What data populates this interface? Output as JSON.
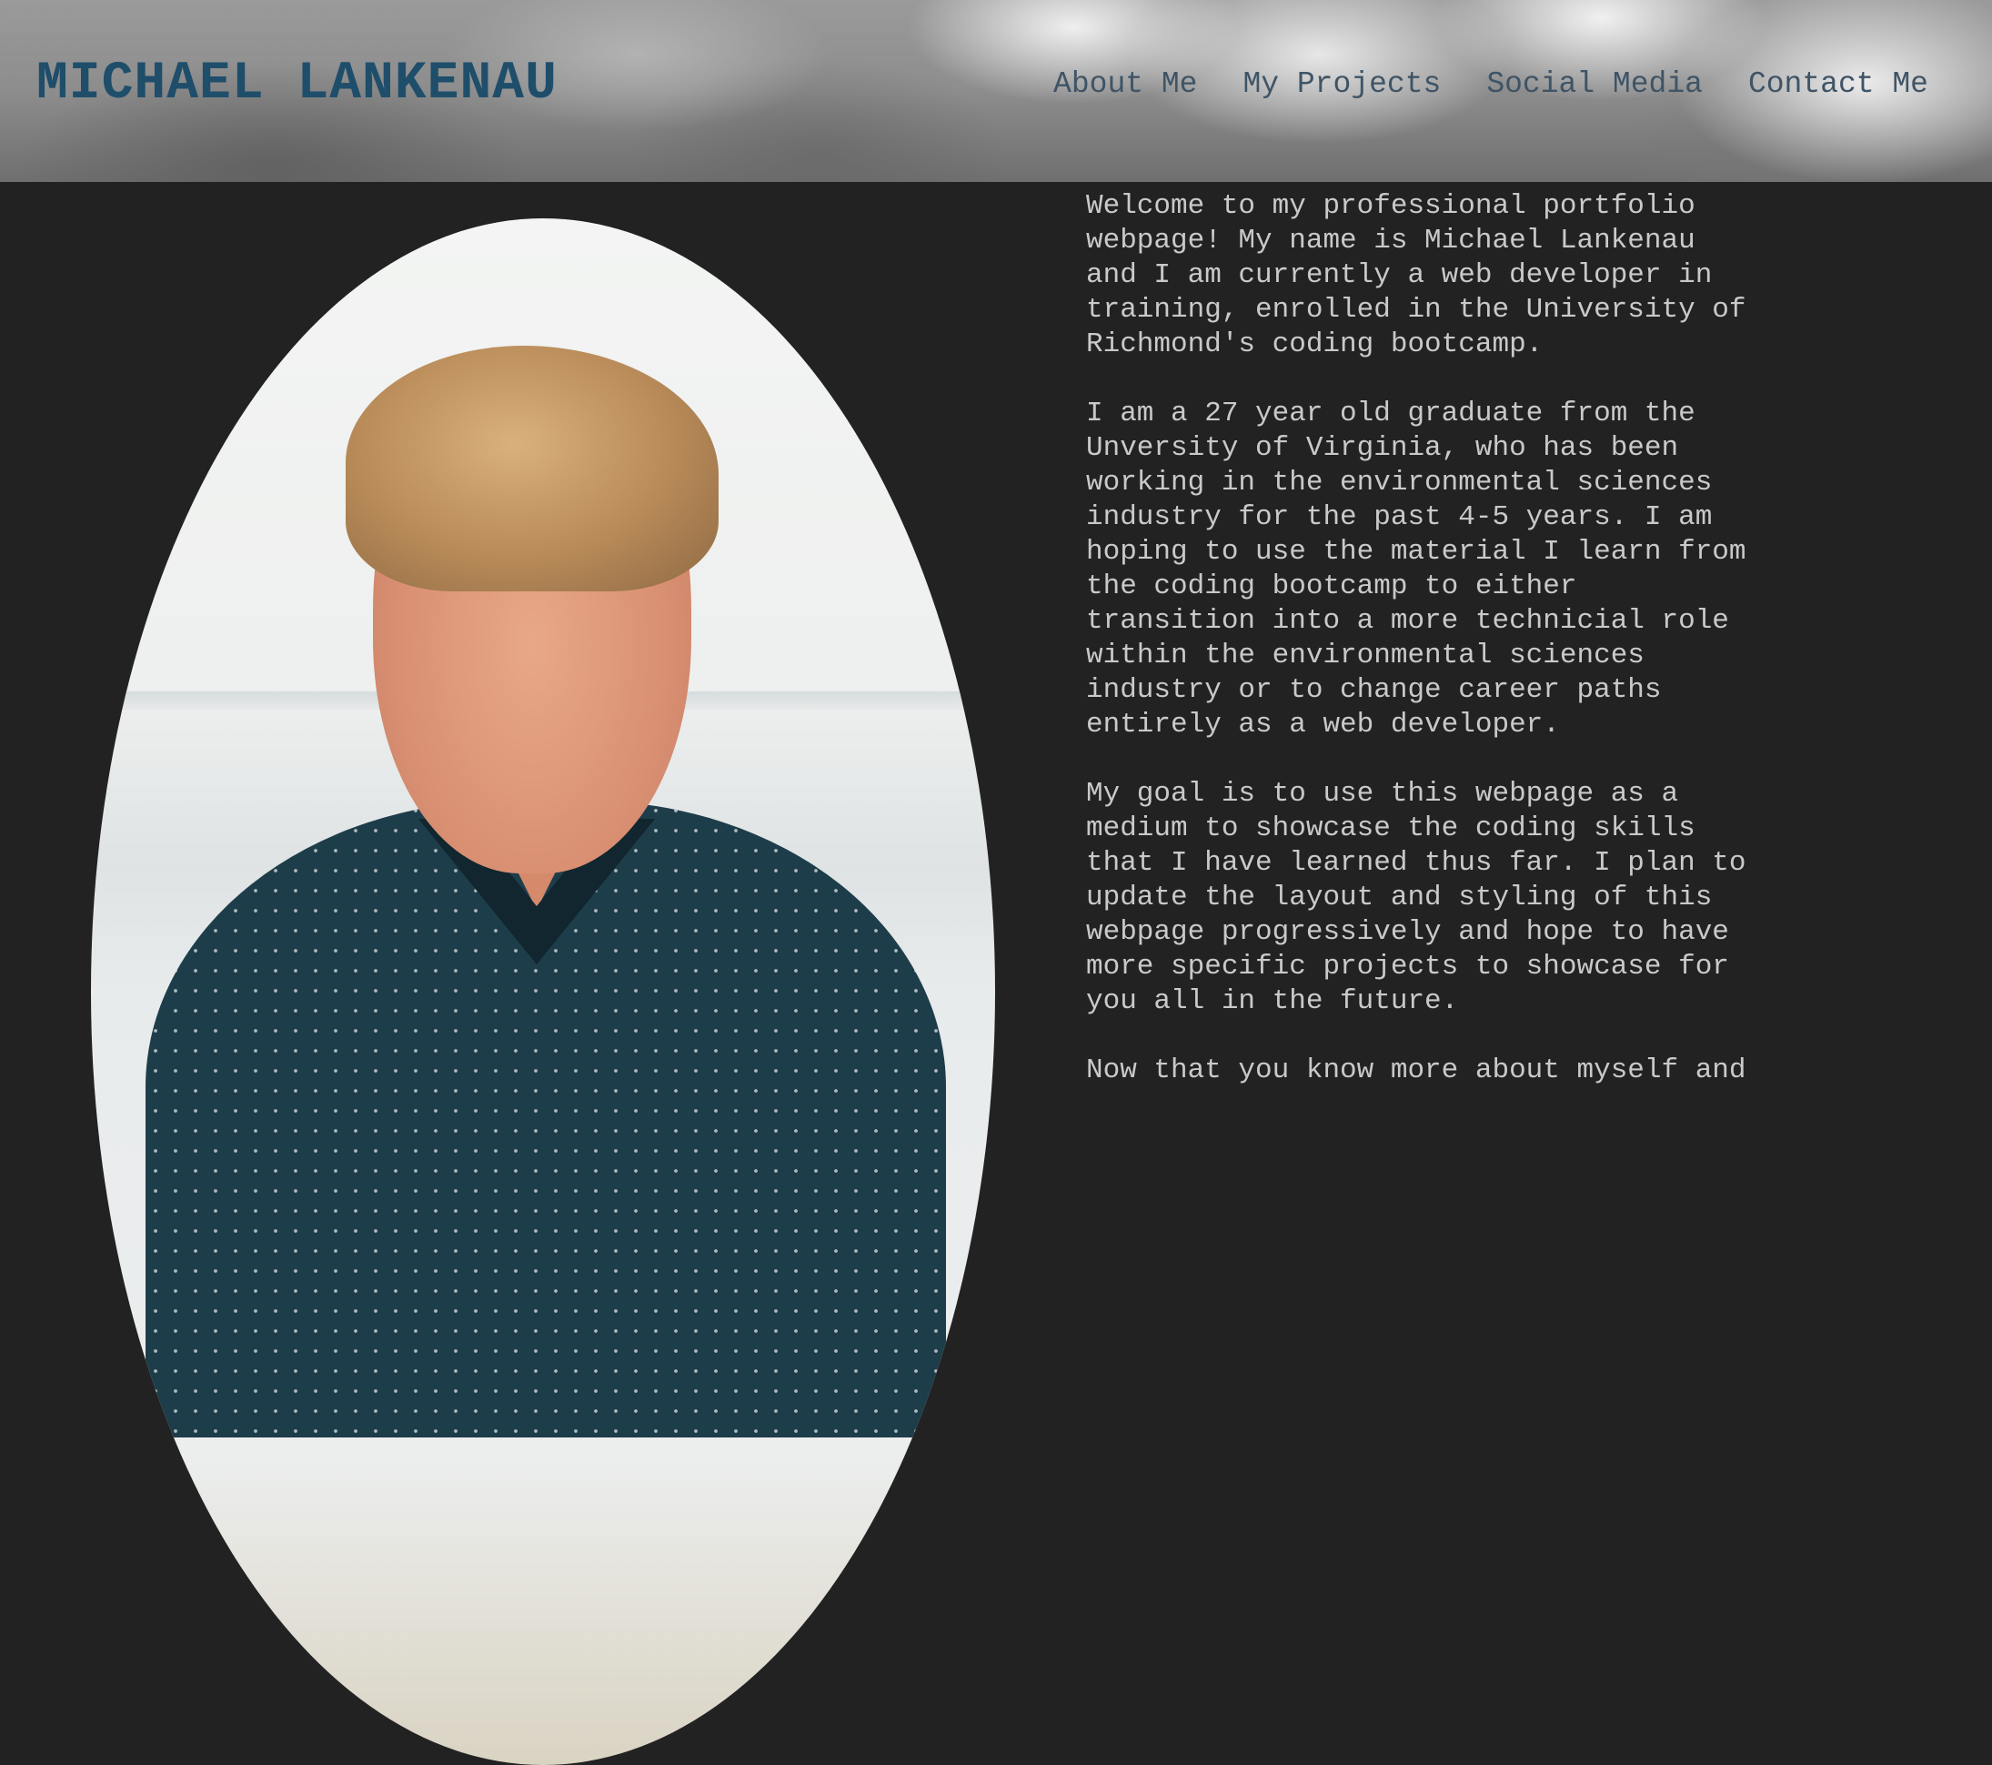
{
  "header": {
    "title": "MICHAEL LANKENAU",
    "nav": [
      {
        "label": "About Me"
      },
      {
        "label": "My Projects"
      },
      {
        "label": "Social Media"
      },
      {
        "label": "Contact Me"
      }
    ]
  },
  "about": {
    "paragraphs": [
      "Welcome to my professional portfolio\nwebpage! My name is Michael Lankenau\nand I am currently a web developer in\ntraining, enrolled in the University of\nRichmond's coding bootcamp.",
      "I am a 27 year old graduate from the\nUnversity of Virginia, who has been\nworking in the environmental sciences\nindustry for the past 4-5 years. I am\nhoping to use the material I learn from\nthe coding bootcamp to either\ntransition into a more technicial role\nwithin the environmental sciences\nindustry or to change career paths\nentirely as a web developer.",
      "My goal is to use this webpage as a\nmedium to showcase the coding skills\nthat I have learned thus far. I plan to\nupdate the layout and styling of this\nwebpage progressively and hope to have\nmore specific projects to showcase for\nyou all in the future.",
      "Now that you know more about myself and"
    ]
  },
  "colors": {
    "brand": "#1f4e6b",
    "nav": "#3f5466",
    "background": "#222222",
    "text": "#c9c9c9"
  }
}
